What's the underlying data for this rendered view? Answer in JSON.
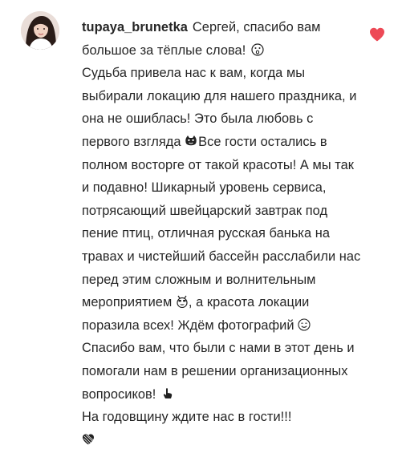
{
  "comment": {
    "username": "tupaya_brunetka",
    "lines": [
      "Сергей, спасибо вам",
      "большое за тёплые слова!",
      "Судьба привела нас к вам, когда мы",
      "выбирали локацию для нашего праздника, и",
      "она не ошиблась! Это была любовь с",
      "первого взгляда",
      "Все гости остались в",
      "полном восторге от такой красоты! А мы так",
      "и подавно! Шикарный уровень сервиса,",
      "потрясающий швейцарский завтрак под",
      "пение птиц, отличная русская банька на",
      "травах и чистейший бассейн расслабили нас",
      "перед этим сложным и волнительным",
      "мероприятием",
      ", а красота локации",
      "поразила всех! Ждём фотографий",
      "Спасибо вам, что были с нами в этот день и",
      "помогали нам в решении организационных",
      "вопросиков!",
      "На годовщину ждите нас в гости!!!"
    ],
    "emoji_icons": [
      "surprised-face-icon",
      "heart-eyes-cat-icon",
      "party-face-icon",
      "smiling-face-icon",
      "pointing-hand-icon",
      "black-heart-icon"
    ],
    "like_icon": "heart-icon",
    "like_color": "#ed4956",
    "liked": true
  }
}
